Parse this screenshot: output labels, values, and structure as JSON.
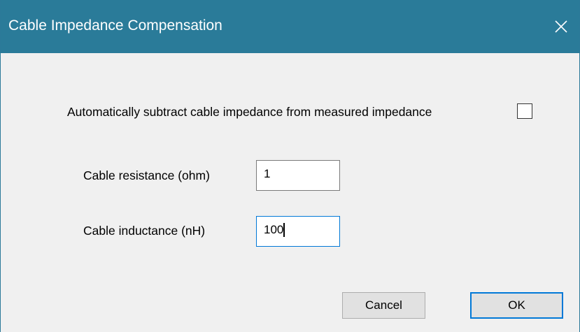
{
  "window": {
    "title": "Cable Impedance Compensation",
    "close_icon": "close-icon"
  },
  "options": {
    "auto_subtract_label": "Automatically subtract cable impedance from measured impedance",
    "auto_subtract_checked": false
  },
  "fields": {
    "resistance_label": "Cable resistance (ohm)",
    "resistance_value": "1",
    "inductance_label": "Cable inductance (nH)",
    "inductance_value": "100"
  },
  "buttons": {
    "cancel_label": "Cancel",
    "ok_label": "OK"
  },
  "colors": {
    "titlebar": "#2a7b99",
    "focus_accent": "#0078d7",
    "background": "#f0f0f0"
  }
}
